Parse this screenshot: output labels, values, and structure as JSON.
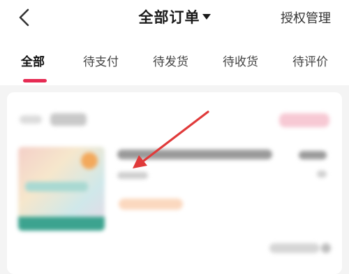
{
  "header": {
    "title": "全部订单",
    "auth_label": "授权管理"
  },
  "tabs": [
    {
      "label": "全部",
      "active": true
    },
    {
      "label": "待支付",
      "active": false
    },
    {
      "label": "待发货",
      "active": false
    },
    {
      "label": "待收货",
      "active": false
    },
    {
      "label": "待评价",
      "active": false
    }
  ],
  "colors": {
    "accent": "#e62b53",
    "annotation_arrow": "#e03a3a"
  },
  "icons": {
    "back": "chevron-left-icon",
    "title_dropdown": "caret-down-icon",
    "annotation": "red-arrow-annotation"
  }
}
